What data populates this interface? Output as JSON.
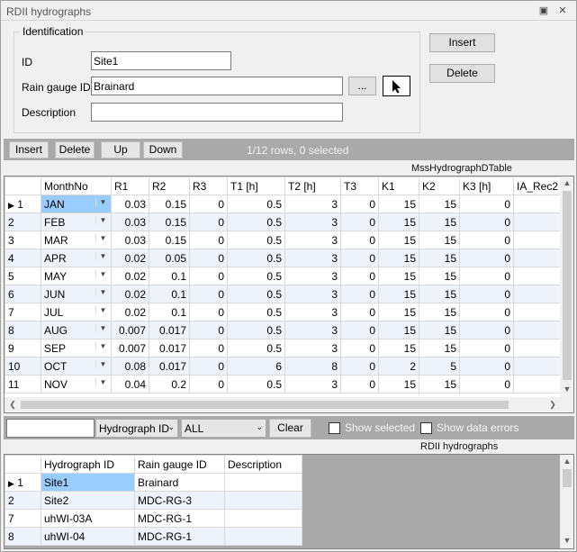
{
  "window": {
    "title": "RDII hydrographs"
  },
  "identification": {
    "legend": "Identification",
    "id_label": "ID",
    "id_value": "Site1",
    "rain_gauge_label": "Rain gauge ID",
    "rain_gauge_value": "Brainard",
    "description_label": "Description",
    "description_value": "",
    "browse_label": "..."
  },
  "actions": {
    "insert_label": "Insert",
    "delete_label": "Delete"
  },
  "toolbar": {
    "insert_label": "Insert",
    "delete_label": "Delete",
    "up_label": "Up",
    "down_label": "Down",
    "row_info": "1/12 rows, 0 selected"
  },
  "upper_grid": {
    "caption": "MssHydrographDTable",
    "columns": [
      "MonthNo",
      "R1",
      "R2",
      "R3",
      "T1 [h]",
      "T2 [h]",
      "T3",
      "K1",
      "K2",
      "K3 [h]",
      "IA_Rec2"
    ],
    "rows": [
      {
        "n": "1",
        "month": "JAN",
        "vals": [
          "0.03",
          "0.15",
          "0",
          "0.5",
          "3",
          "0",
          "15",
          "15",
          "0",
          ""
        ]
      },
      {
        "n": "2",
        "month": "FEB",
        "vals": [
          "0.03",
          "0.15",
          "0",
          "0.5",
          "3",
          "0",
          "15",
          "15",
          "0",
          ""
        ]
      },
      {
        "n": "3",
        "month": "MAR",
        "vals": [
          "0.03",
          "0.15",
          "0",
          "0.5",
          "3",
          "0",
          "15",
          "15",
          "0",
          ""
        ]
      },
      {
        "n": "4",
        "month": "APR",
        "vals": [
          "0.02",
          "0.05",
          "0",
          "0.5",
          "3",
          "0",
          "15",
          "15",
          "0",
          ""
        ]
      },
      {
        "n": "5",
        "month": "MAY",
        "vals": [
          "0.02",
          "0.1",
          "0",
          "0.5",
          "3",
          "0",
          "15",
          "15",
          "0",
          ""
        ]
      },
      {
        "n": "6",
        "month": "JUN",
        "vals": [
          "0.02",
          "0.1",
          "0",
          "0.5",
          "3",
          "0",
          "15",
          "15",
          "0",
          ""
        ]
      },
      {
        "n": "7",
        "month": "JUL",
        "vals": [
          "0.02",
          "0.1",
          "0",
          "0.5",
          "3",
          "0",
          "15",
          "15",
          "0",
          ""
        ]
      },
      {
        "n": "8",
        "month": "AUG",
        "vals": [
          "0.007",
          "0.017",
          "0",
          "0.5",
          "3",
          "0",
          "15",
          "15",
          "0",
          ""
        ]
      },
      {
        "n": "9",
        "month": "SEP",
        "vals": [
          "0.007",
          "0.017",
          "0",
          "0.5",
          "3",
          "0",
          "15",
          "15",
          "0",
          ""
        ]
      },
      {
        "n": "10",
        "month": "OCT",
        "vals": [
          "0.08",
          "0.017",
          "0",
          "6",
          "8",
          "0",
          "2",
          "5",
          "0",
          ""
        ]
      },
      {
        "n": "11",
        "month": "NOV",
        "vals": [
          "0.04",
          "0.2",
          "0",
          "0.5",
          "3",
          "0",
          "15",
          "15",
          "0",
          ""
        ]
      }
    ]
  },
  "filter": {
    "search_value": "",
    "field_select": "Hydrograph ID",
    "value_select": "ALL",
    "clear_label": "Clear",
    "show_selected_label": "Show selected",
    "show_errors_label": "Show data errors"
  },
  "lower_grid": {
    "caption": "RDII hydrographs",
    "columns": [
      "Hydrograph ID",
      "Rain gauge ID",
      "Description"
    ],
    "rows": [
      {
        "n": "1",
        "id": "Site1",
        "gauge": "Brainard",
        "desc": ""
      },
      {
        "n": "2",
        "id": "Site2",
        "gauge": "MDC-RG-3",
        "desc": ""
      },
      {
        "n": "7",
        "id": "uhWI-03A",
        "gauge": "MDC-RG-1",
        "desc": ""
      },
      {
        "n": "8",
        "id": "uhWI-04",
        "gauge": "MDC-RG-1",
        "desc": ""
      }
    ]
  },
  "colors": {
    "selection": "#99ccff",
    "toolbar": "#a9a9a9",
    "alt_row": "#eef2fa"
  }
}
